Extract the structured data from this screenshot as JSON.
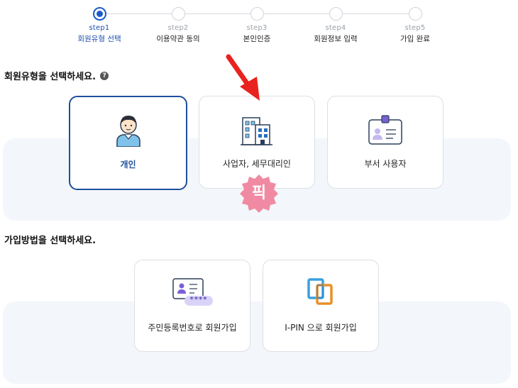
{
  "steps": [
    {
      "num": "step1",
      "label": "회원유형 선택",
      "active": true
    },
    {
      "num": "step2",
      "label": "이용약관 동의",
      "active": false
    },
    {
      "num": "step3",
      "label": "본인인증",
      "active": false
    },
    {
      "num": "step4",
      "label": "회원정보 입력",
      "active": false
    },
    {
      "num": "step5",
      "label": "가입 완료",
      "active": false
    }
  ],
  "member_type": {
    "title": "회원유형을 선택하세요.",
    "help": "?",
    "options": [
      {
        "label": "개인",
        "icon": "person-icon",
        "selected": true
      },
      {
        "label": "사업자, 세무대리인",
        "icon": "building-icon",
        "selected": false
      },
      {
        "label": "부서 사용자",
        "icon": "id-badge-icon",
        "selected": false
      }
    ]
  },
  "join_method": {
    "title": "가입방법을 선택하세요.",
    "options": [
      {
        "label": "주민등록번호로 회원가입",
        "icon": "id-card-icon",
        "mask": "****"
      },
      {
        "label": "I-PIN 으로 회원가입",
        "icon": "ipin-icon"
      }
    ]
  },
  "annotation": {
    "badge": "픽",
    "arrow_color": "#e8231f",
    "badge_color": "#f08aa2"
  },
  "colors": {
    "accent": "#1a5cc7",
    "band": "#f3f6fb"
  }
}
